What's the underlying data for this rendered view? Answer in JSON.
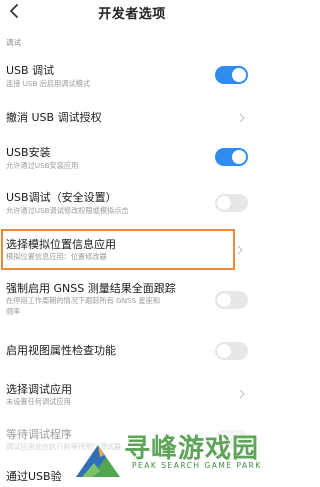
{
  "header": {
    "title": "开发者选项",
    "back_icon": "chevron-left-icon"
  },
  "section": {
    "title": "调试"
  },
  "settings": [
    {
      "title": "USB 调试",
      "subtitle": "连接 USB 后启用调试模式",
      "control": "toggle",
      "on": true
    },
    {
      "title": "撤消 USB 调试授权",
      "control": "chevron"
    },
    {
      "title": "USB安装",
      "subtitle": "允许通过USB安装应用",
      "control": "toggle",
      "on": true
    },
    {
      "title": "USB调试（安全设置）",
      "subtitle": "允许通过USB调试修改权限或模拟点击",
      "control": "toggle",
      "on": false
    },
    {
      "title": "选择模拟位置信息应用",
      "subtitle": "模拟位置信息应用：位置修改器",
      "control": "chevron",
      "highlighted": true
    },
    {
      "title": "强制启用 GNSS 测量结果全面跟踪",
      "subtitle": "在停用工作周期的情况下跟踪所有 GNSS 星座和",
      "subtitle2": "频率",
      "control": "toggle",
      "on": false
    },
    {
      "title": "启用视图属性检查功能",
      "control": "toggle",
      "on": false
    },
    {
      "title": "选择调试应用",
      "subtitle": "未设置任何调试应用",
      "control": "chevron"
    },
    {
      "title": "等待调试程序",
      "subtitle": "调试应用会在执行前等待附加调试器",
      "control": "toggle",
      "on": false,
      "disabled": true
    },
    {
      "title": "通过USB验",
      "control": "none"
    }
  ],
  "colors": {
    "toggle_on": "#2f8cf0",
    "toggle_off": "#e7e7e7",
    "highlight": "#f0893a"
  },
  "watermark": {
    "text": "寻峰游戏园",
    "subtext": "PEAK SEARCH GAME PARK"
  }
}
